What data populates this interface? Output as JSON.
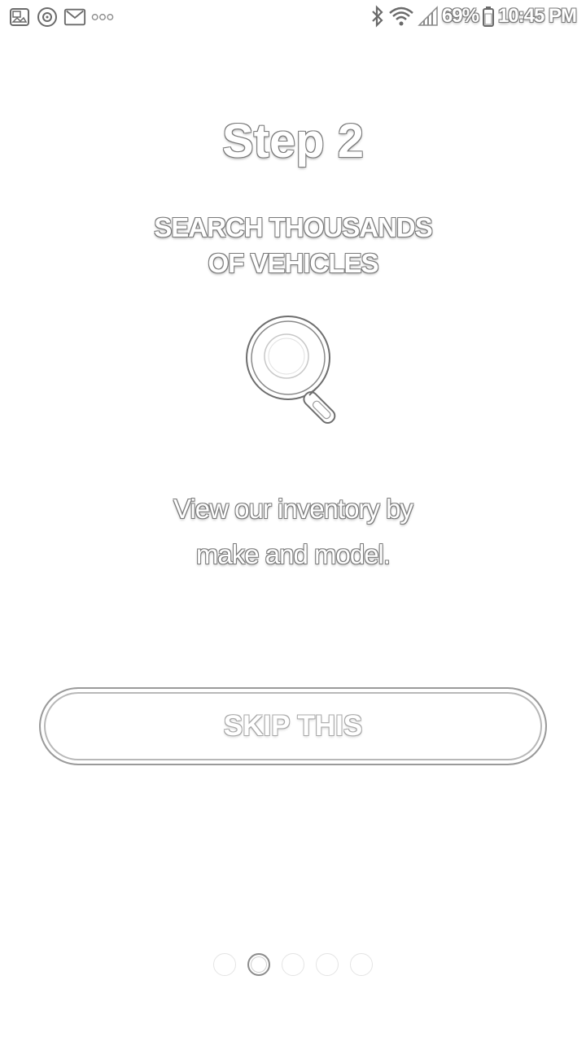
{
  "status_bar": {
    "left_icons": [
      "photo-notification-icon",
      "record-notification-icon",
      "gmail-notification-icon",
      "more-notifications-icon"
    ],
    "right_icons": [
      "bluetooth-icon",
      "wifi-icon",
      "signal-icon",
      "battery-icon"
    ],
    "battery_percent": "69%",
    "time": "10:45 PM"
  },
  "onboarding": {
    "step_title": "Step 2",
    "headline_lines": [
      "SEARCH THOUSANDS",
      "OF VEHICLES"
    ],
    "illustration": "magnifying-glass-icon",
    "description_lines": [
      "View our inventory by",
      "make and model."
    ],
    "skip_label": "SKIP THIS",
    "pages_total": 5,
    "current_page": 2
  },
  "colors": {
    "background": "#ffffff",
    "text_fill": "#ffffff",
    "outline": "#7a7a7a"
  }
}
